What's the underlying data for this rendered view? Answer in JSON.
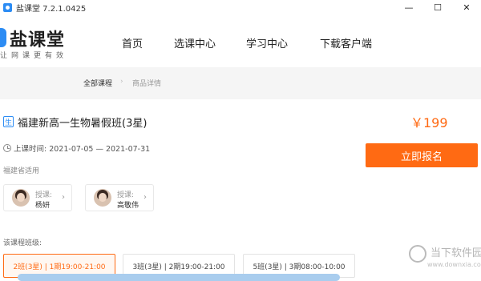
{
  "window": {
    "title": "盐课堂 7.2.1.0425",
    "controls": {
      "minimize": "—",
      "maximize": "☐",
      "close": "✕"
    }
  },
  "header": {
    "brand": "盐课堂",
    "slogan": "让网课更有效",
    "nav": [
      "首页",
      "选课中心",
      "学习中心",
      "下载客户端"
    ]
  },
  "breadcrumb": {
    "root": "全部课程",
    "separator": "›",
    "current": "商品详情"
  },
  "course": {
    "subject_tag": "生",
    "title": "福建新高一生物暑假班(3星)",
    "price": "￥199",
    "time": "上课时间: 2021-07-05 — 2021-07-31",
    "region": "福建省适用",
    "enroll_label": "立即报名",
    "teachers": [
      {
        "role": "授课:",
        "name": "杨妍"
      },
      {
        "role": "授课:",
        "name": "高敬伟"
      }
    ],
    "class_label": "该课程班级:",
    "classes": [
      {
        "label": "2班(3星) | 1期19:00-21:00",
        "selected": true
      },
      {
        "label": "3班(3星) | 2期19:00-21:00",
        "selected": false
      },
      {
        "label": "5班(3星) | 3期08:00-10:00",
        "selected": false
      }
    ]
  },
  "watermark": {
    "text": "当下软件园",
    "url": "www.downxia.com"
  },
  "colors": {
    "accent": "#ff6a13",
    "brand": "#2c8cf4"
  }
}
